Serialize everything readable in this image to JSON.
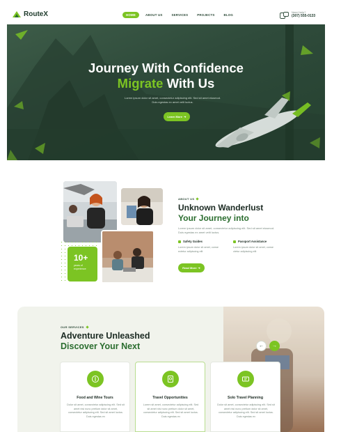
{
  "header": {
    "logo_text": "RouteX",
    "nav": [
      "HOME",
      "ABOUT US",
      "SERVICES",
      "PROJECTS",
      "BLOG"
    ],
    "contact_label": "Need help?",
    "contact_phone": "(307) 555-0133"
  },
  "hero": {
    "title_line1": "Journey With Confidence",
    "title_accent": "Migrate",
    "title_rest": " With Us",
    "description": "Lorem ipsum dolor sit amet, consectetur adipiscing elit. Sed sit amet eiusmod. Duis egestas ex amet velit luctus.",
    "button_label": "Learn More"
  },
  "about": {
    "tag": "ABOUT US",
    "title_line1": "Unknown Wanderlust",
    "title_line2": "Your Journey into",
    "description": "Lorem ipsum dolor sit amet, consectetur adipiscing elit. Sed sit amet eiusmod. Duis egestas ex amet velit luctus.",
    "experience_number": "10+",
    "experience_label": "years of experience",
    "features": [
      {
        "title": "Safety Guides",
        "desc": "Lorem ipsum dolor sit amet, conse ectetur adipiscing elit"
      },
      {
        "title": "Passport Assistance",
        "desc": "Lorem ipsum dolor sit amet, conse ctetur adipiscing elit"
      }
    ],
    "button_label": "Read More"
  },
  "services": {
    "tag": "OUR SERVICES",
    "title_line1": "Adventure Unleashed",
    "title_line2": "Discover Your Next",
    "cards": [
      {
        "title": "Food and Wine Tours",
        "desc": "Dolor sit amet, consectetur adipiscing elit. Sed sit amet nisi nunc pretium dolor sit amet, consectetur adipiscing elit. Sed sit amet luctus. Duis egestas ex",
        "icon": "food-icon"
      },
      {
        "title": "Travel Opportunities",
        "desc": "Lorem sit amet, consectetur adipiscing elit. Sed sit amet nisi nunc pretium dolor sit amet, consectetur adipiscing elit. Sed sit amet luctus. Duis egestas ex",
        "icon": "passport-icon"
      },
      {
        "title": "Solo Travel Planning",
        "desc": "Dolor sit amet, consectetur adipiscing elit. Sed sit amet nisi nunc pretium dolor sit amet, consectetur adipiscing elit. Sed sit amet luctus. Duis egestas ex",
        "icon": "ticket-icon"
      }
    ]
  },
  "colors": {
    "accent": "#7cc423",
    "dark_green": "#2b6d2f",
    "hero_bg": "#2f4b3b"
  }
}
